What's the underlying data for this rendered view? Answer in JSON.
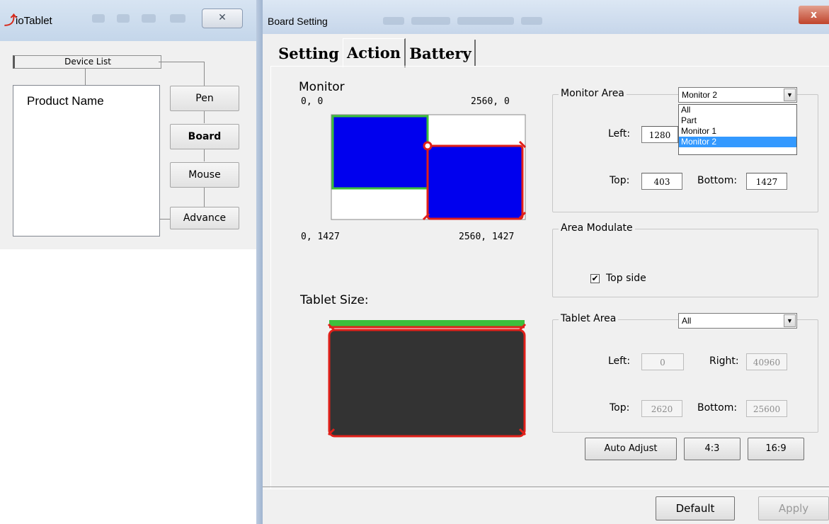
{
  "io_window": {
    "title": "ioTablet",
    "close_glyph": "✕",
    "device_list_header": "Device List",
    "product_name": "Product Name",
    "buttons": {
      "pen": "Pen",
      "board": "Board",
      "mouse": "Mouse",
      "advance": "Advance"
    }
  },
  "board_window": {
    "title": "Board Setting",
    "close_glyph": "x",
    "tabs": {
      "setting": "Setting",
      "action": "Action",
      "battery": "Battery"
    },
    "monitor": {
      "heading": "Monitor",
      "top_left": "0,  0",
      "top_right": "2560,  0",
      "bottom_left": "0,  1427",
      "bottom_right": "2560,  1427"
    },
    "tablet_size_heading": "Tablet Size:",
    "monitor_area": {
      "title": "Monitor Area",
      "selected": "Monitor 2",
      "options": [
        "All",
        "Part",
        "Monitor 1",
        "Monitor 2"
      ],
      "left_label": "Left:",
      "left_value": "1280",
      "top_label": "Top:",
      "top_value": "403",
      "bottom_label": "Bottom:",
      "bottom_value": "1427"
    },
    "area_modulate": {
      "title": "Area Modulate",
      "checkbox_label": "Top side",
      "checked_glyph": "✔"
    },
    "tablet_area": {
      "title": "Tablet Area",
      "selected": "All",
      "left_label": "Left:",
      "left_value": "0",
      "right_label": "Right:",
      "right_value": "40960",
      "top_label": "Top:",
      "top_value": "2620",
      "bottom_label": "Bottom:",
      "bottom_value": "25600"
    },
    "buttons": {
      "auto_adjust": "Auto Adjust",
      "ratio_4_3": "4:3",
      "ratio_16_9": "16:9",
      "default": "Default",
      "apply": "Apply"
    },
    "dropdown_arrow": "▼",
    "colors": {
      "monitor_fill": "#0000ee",
      "selection_border": "#e0201a",
      "active_monitor_border": "#3cbf3c",
      "tablet_fill": "#333333"
    }
  }
}
